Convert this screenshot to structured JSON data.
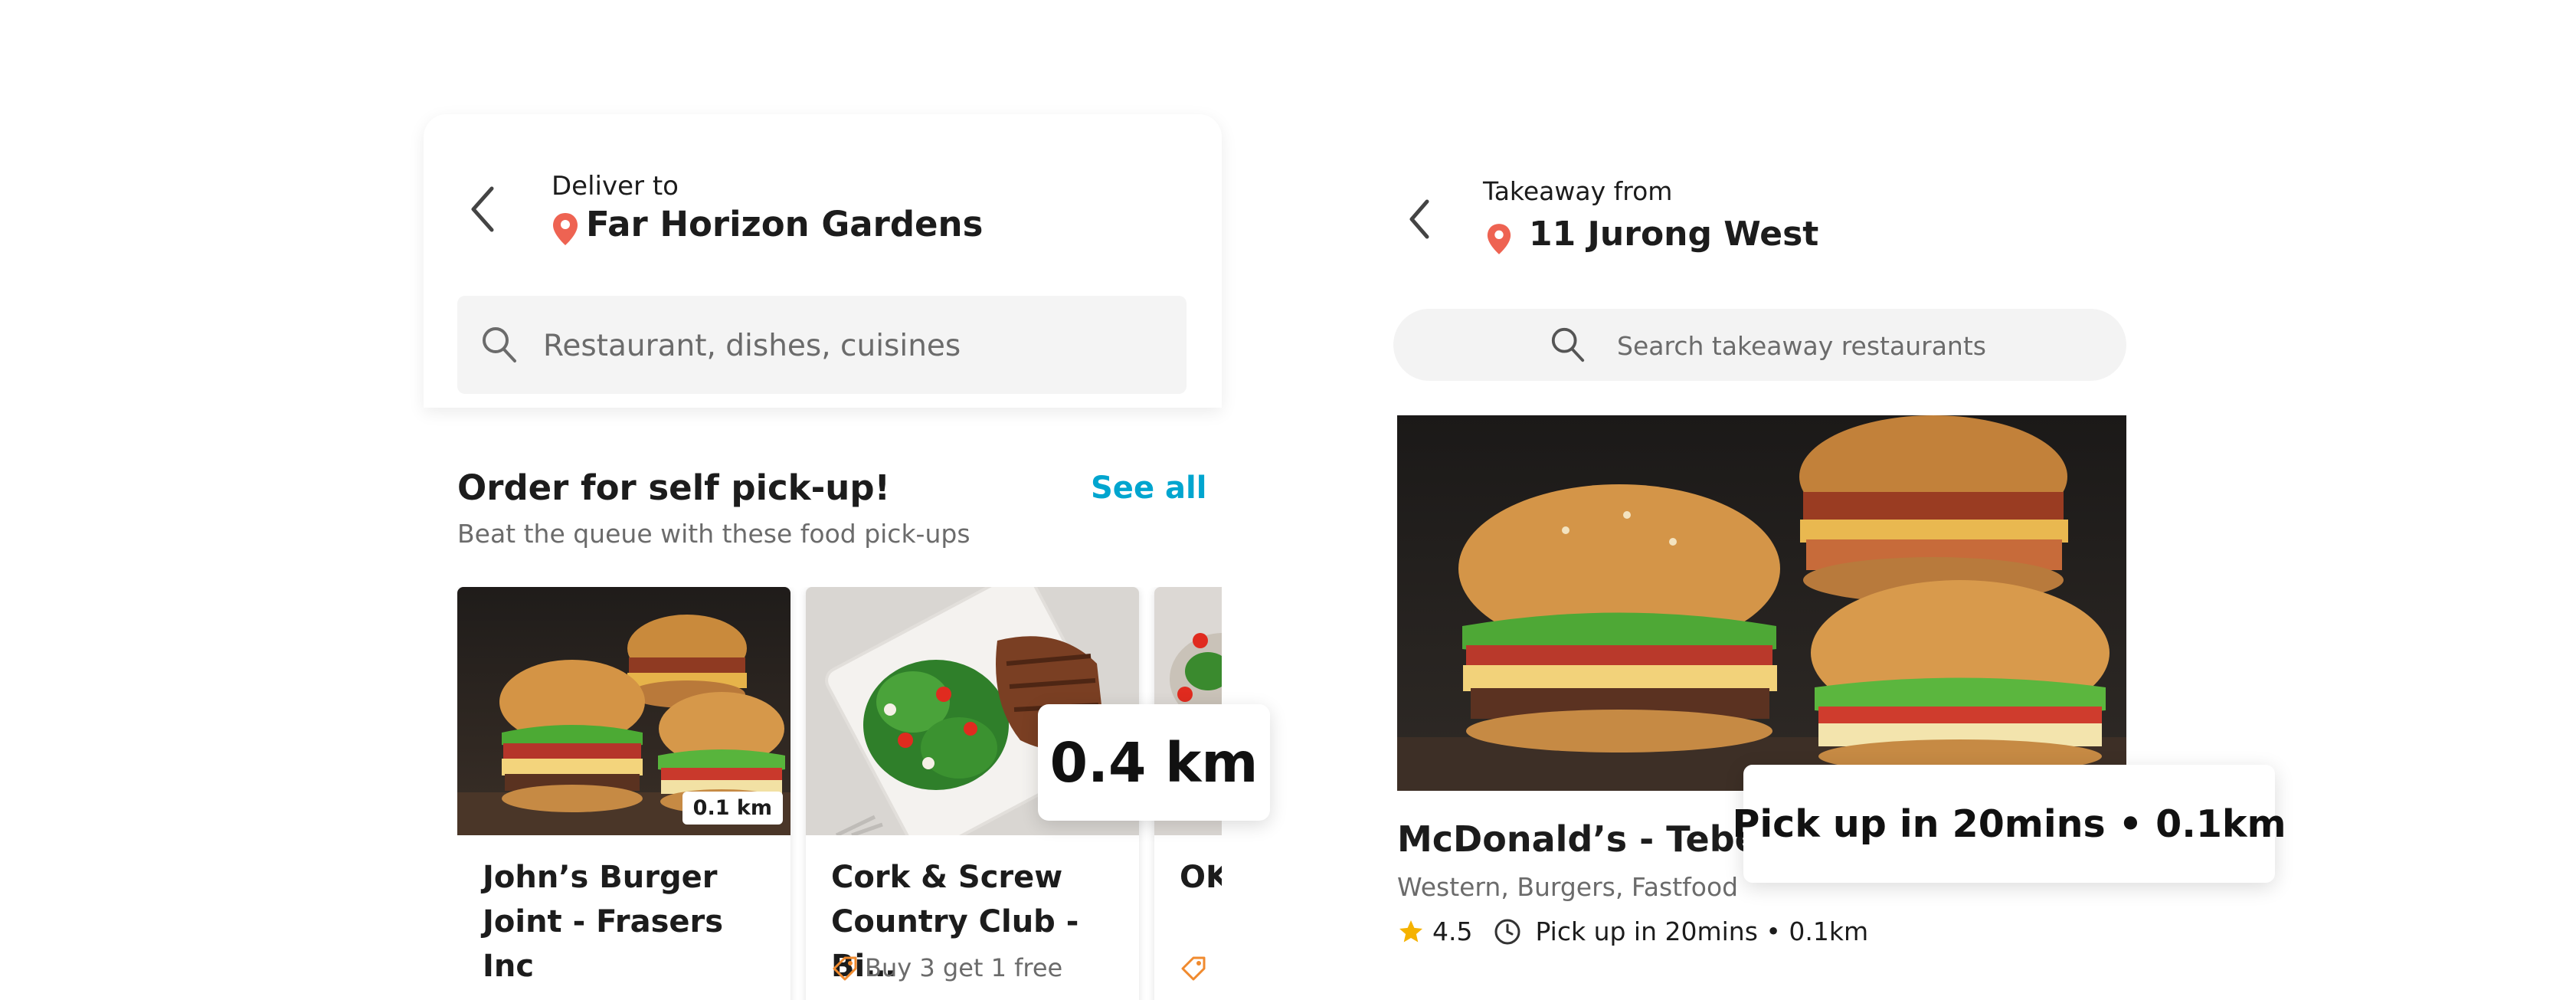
{
  "colors": {
    "accent": "#00a5cf",
    "pin": "#ee6352",
    "star": "#f5b200",
    "promo_tag": "#f08a2e"
  },
  "left": {
    "header": {
      "label": "Deliver to",
      "location": "Far Horizon Gardens",
      "back_icon": "chevron-left-icon",
      "pin_icon": "location-pin-icon"
    },
    "search": {
      "placeholder": "Restaurant, dishes, cuisines",
      "icon": "search-icon"
    },
    "section": {
      "title": "Order for self pick-up!",
      "subtitle": "Beat the queue with these food pick-ups",
      "see_all": "See all"
    },
    "cards": [
      {
        "name": "John’s Burger Joint - Frasers Inc",
        "distance": "0.1 km",
        "image": "burgers-photo"
      },
      {
        "name": "Cork & Screw Country Club - Bi…",
        "promo": "Buy 3 get 1 free",
        "promo_icon": "tag-icon",
        "image": "steak-salad-photo"
      },
      {
        "name": "OK Inc",
        "image": "food-photo"
      }
    ],
    "callout": "0.4 km"
  },
  "right": {
    "header": {
      "label": "Takeaway from",
      "location": "11 Jurong West",
      "back_icon": "chevron-left-icon",
      "pin_icon": "location-pin-icon"
    },
    "search": {
      "placeholder": "Search takeaway restaurants",
      "icon": "search-icon"
    },
    "restaurant": {
      "name": "McDonald’s - Tebet",
      "cuisine": "Western, Burgers, Fastfood",
      "rating": "4.5",
      "pickup": "Pick up in 20mins • 0.1km",
      "image": "burgers-photo"
    },
    "callout": "Pick up in 20mins • 0.1km"
  }
}
